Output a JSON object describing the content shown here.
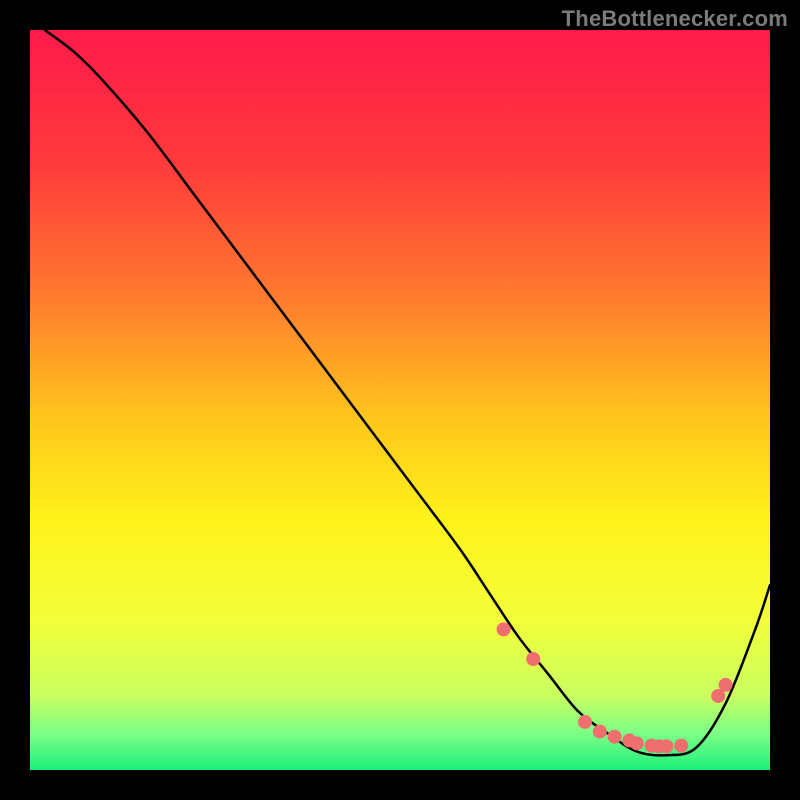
{
  "watermark": "TheBottlenecker.com",
  "chart_data": {
    "type": "line",
    "title": "",
    "xlabel": "",
    "ylabel": "",
    "xlim": [
      0,
      100
    ],
    "ylim": [
      0,
      100
    ],
    "grid": false,
    "background_gradient": {
      "stops": [
        {
          "offset": 0.0,
          "color": "#ff1a4a"
        },
        {
          "offset": 0.18,
          "color": "#ff3a3c"
        },
        {
          "offset": 0.36,
          "color": "#ff7a2e"
        },
        {
          "offset": 0.52,
          "color": "#ffc41c"
        },
        {
          "offset": 0.66,
          "color": "#fff21a"
        },
        {
          "offset": 0.8,
          "color": "#f2ff3a"
        },
        {
          "offset": 0.9,
          "color": "#c8ff60"
        },
        {
          "offset": 0.95,
          "color": "#7dff86"
        },
        {
          "offset": 1.0,
          "color": "#1cf07c"
        }
      ]
    },
    "series": [
      {
        "name": "bottleneck-curve",
        "color": "#000000",
        "stroke_width": 2.5,
        "x": [
          2,
          6,
          10,
          16,
          22,
          28,
          34,
          40,
          46,
          52,
          58,
          62,
          66,
          70,
          74,
          78,
          82,
          86,
          90,
          94,
          98,
          100
        ],
        "y": [
          100,
          97,
          93,
          86,
          78,
          70,
          62,
          54,
          46,
          38,
          30,
          24,
          18,
          13,
          8,
          5,
          2.5,
          2,
          3,
          9,
          19,
          25
        ]
      }
    ],
    "markers": {
      "name": "data-points",
      "color": "#ef6e6e",
      "radius": 7,
      "x": [
        64,
        68,
        75,
        77,
        79,
        81,
        82,
        84,
        85,
        86,
        88,
        93,
        94
      ],
      "y": [
        19,
        15,
        6.5,
        5.2,
        4.5,
        4.0,
        3.6,
        3.3,
        3.2,
        3.2,
        3.3,
        10,
        11.5
      ]
    }
  }
}
